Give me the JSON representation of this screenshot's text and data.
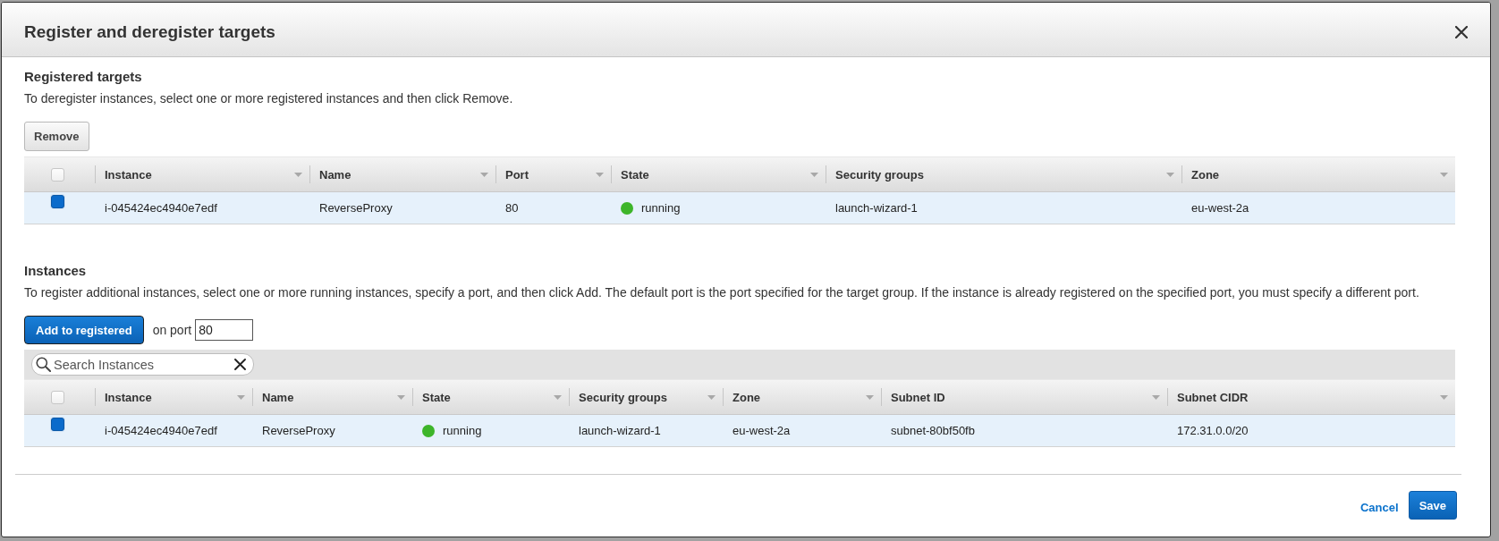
{
  "dialog": {
    "title": "Register and deregister targets"
  },
  "registered": {
    "heading": "Registered targets",
    "description": "To deregister instances, select one or more registered instances and then click Remove.",
    "remove_button": "Remove",
    "table": {
      "select_all": false,
      "columns": [
        "Instance",
        "Name",
        "Port",
        "State",
        "Security groups",
        "Zone"
      ],
      "rows": [
        {
          "selected": true,
          "cells": [
            {
              "text": "i-045424ec4940e7edf"
            },
            {
              "text": "ReverseProxy"
            },
            {
              "text": "80"
            },
            {
              "text": "running",
              "color": "#3db52a"
            },
            {
              "text": "launch-wizard-1"
            },
            {
              "text": "eu-west-2a"
            }
          ]
        }
      ]
    }
  },
  "instances": {
    "heading": "Instances",
    "description": "To register additional instances, select one or more running instances, specify a port, and then click Add. The default port is the port specified for the target group. If the instance is already registered on the specified port, you must specify a different port.",
    "add_button": "Add to registered",
    "port_label": "on port",
    "port_value": "80",
    "search": {
      "placeholder": "Search Instances"
    },
    "table": {
      "select_all": false,
      "columns": [
        "Instance",
        "Name",
        "State",
        "Security groups",
        "Zone",
        "Subnet ID",
        "Subnet CIDR"
      ],
      "rows": [
        {
          "selected": true,
          "cells": [
            {
              "text": "i-045424ec4940e7edf"
            },
            {
              "text": "ReverseProxy"
            },
            {
              "text": "running",
              "color": "#3db52a"
            },
            {
              "text": "launch-wizard-1"
            },
            {
              "text": "eu-west-2a"
            },
            {
              "text": "subnet-80bf50fb"
            },
            {
              "text": "172.31.0.0/20"
            }
          ]
        }
      ]
    }
  },
  "footer": {
    "cancel": "Cancel",
    "save": "Save"
  }
}
